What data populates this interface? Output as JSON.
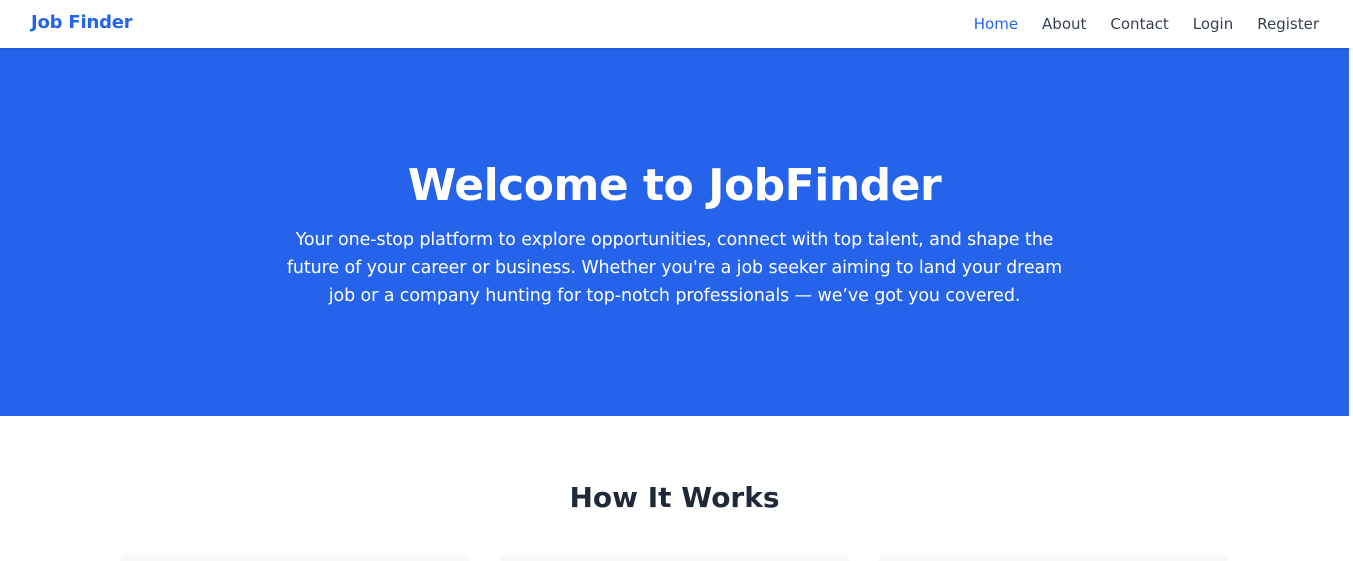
{
  "navbar": {
    "brand": "Job Finder",
    "links": [
      {
        "label": "Home",
        "active": true
      },
      {
        "label": "About",
        "active": false
      },
      {
        "label": "Contact",
        "active": false
      },
      {
        "label": "Login",
        "active": false
      },
      {
        "label": "Register",
        "active": false
      }
    ]
  },
  "hero": {
    "title": "Welcome to JobFinder",
    "subtitle": "Your one-stop platform to explore opportunities, connect with top talent, and shape the future of your career or business. Whether you're a job seeker aiming to land your dream job or a company hunting for top-notch professionals — we’ve got you covered."
  },
  "how_it_works": {
    "title": "How It Works"
  },
  "colors": {
    "accent": "#2563eb",
    "text_dark": "#1f2937",
    "nav_text": "#374151",
    "hero_text": "#ffffff"
  }
}
